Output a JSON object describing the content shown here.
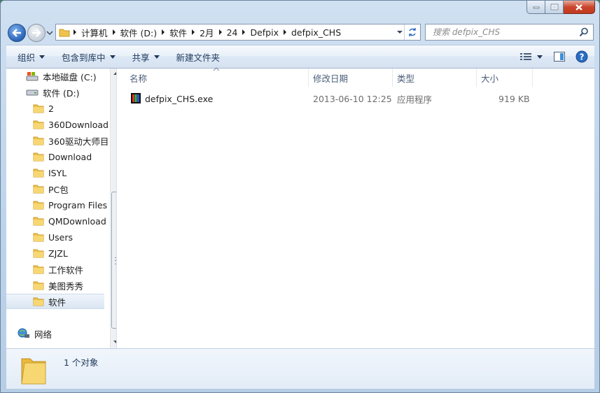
{
  "window": {
    "title": ""
  },
  "address": {
    "crumbs": [
      "计算机",
      "软件 (D:)",
      "软件",
      "2月",
      "24",
      "Defpix",
      "defpix_CHS"
    ]
  },
  "search": {
    "placeholder": "搜索 defpix_CHS"
  },
  "toolbar": {
    "organize": "组织",
    "include_in_library": "包含到库中",
    "share": "共享",
    "new_folder": "新建文件夹"
  },
  "navpane": {
    "items": [
      {
        "label": "本地磁盘 (C:)",
        "icon": "drive-c-icon"
      },
      {
        "label": "软件 (D:)",
        "icon": "drive-d-icon"
      },
      {
        "label": "2",
        "icon": "folder-icon"
      },
      {
        "label": "360Download",
        "icon": "folder-icon"
      },
      {
        "label": "360驱动大师目",
        "icon": "folder-icon"
      },
      {
        "label": "Download",
        "icon": "folder-icon"
      },
      {
        "label": "ISYL",
        "icon": "folder-icon"
      },
      {
        "label": "PC包",
        "icon": "folder-icon"
      },
      {
        "label": "Program Files",
        "icon": "folder-icon"
      },
      {
        "label": "QMDownload",
        "icon": "folder-icon"
      },
      {
        "label": "Users",
        "icon": "folder-icon"
      },
      {
        "label": "ZJZL",
        "icon": "folder-icon"
      },
      {
        "label": "工作软件",
        "icon": "folder-icon"
      },
      {
        "label": "美图秀秀",
        "icon": "folder-icon"
      },
      {
        "label": "软件",
        "icon": "folder-icon",
        "selected": true
      },
      {
        "label": "网络",
        "icon": "network-icon"
      }
    ]
  },
  "columns": {
    "name": "名称",
    "modified": "修改日期",
    "type": "类型",
    "size": "大小"
  },
  "files": [
    {
      "name": "defpix_CHS.exe",
      "modified": "2013-06-10 12:25",
      "type": "应用程序",
      "size": "919 KB"
    }
  ],
  "details": {
    "count": "1 个对象"
  },
  "colors": {
    "selection": "#dbe6f3",
    "folder": "#f0c44c",
    "accent": "#1e395b"
  }
}
